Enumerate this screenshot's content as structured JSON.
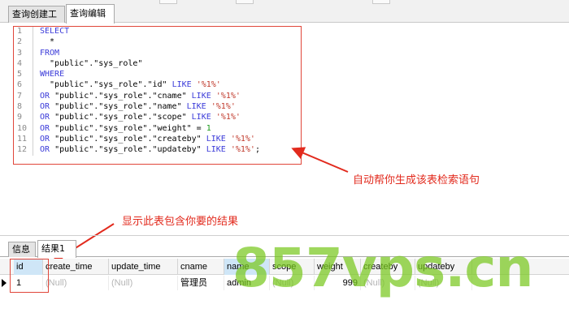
{
  "top_tabs": [
    "查询创建工具",
    "查询编辑器"
  ],
  "active_top_tab": 1,
  "sql": {
    "lines": [
      {
        "n": "1",
        "parts": [
          {
            "t": "SELECT",
            "c": "kw"
          }
        ]
      },
      {
        "n": "2",
        "parts": [
          {
            "t": "  *",
            "c": ""
          }
        ]
      },
      {
        "n": "3",
        "parts": [
          {
            "t": "FROM",
            "c": "kw"
          }
        ]
      },
      {
        "n": "4",
        "parts": [
          {
            "t": "  \"public\".\"sys_role\"",
            "c": ""
          }
        ]
      },
      {
        "n": "5",
        "parts": [
          {
            "t": "WHERE",
            "c": "kw"
          }
        ]
      },
      {
        "n": "6",
        "parts": [
          {
            "t": "  \"public\".\"sys_role\".\"id\" ",
            "c": ""
          },
          {
            "t": "LIKE",
            "c": "kw"
          },
          {
            "t": " ",
            "c": ""
          },
          {
            "t": "'%1%'",
            "c": "str"
          }
        ]
      },
      {
        "n": "7",
        "parts": [
          {
            "t": "OR",
            "c": "kw"
          },
          {
            "t": " \"public\".\"sys_role\".\"cname\" ",
            "c": ""
          },
          {
            "t": "LIKE",
            "c": "kw"
          },
          {
            "t": " ",
            "c": ""
          },
          {
            "t": "'%1%'",
            "c": "str"
          }
        ]
      },
      {
        "n": "8",
        "parts": [
          {
            "t": "OR",
            "c": "kw"
          },
          {
            "t": " \"public\".\"sys_role\".\"name\" ",
            "c": ""
          },
          {
            "t": "LIKE",
            "c": "kw"
          },
          {
            "t": " ",
            "c": ""
          },
          {
            "t": "'%1%'",
            "c": "str"
          }
        ]
      },
      {
        "n": "9",
        "parts": [
          {
            "t": "OR",
            "c": "kw"
          },
          {
            "t": " \"public\".\"sys_role\".\"scope\" ",
            "c": ""
          },
          {
            "t": "LIKE",
            "c": "kw"
          },
          {
            "t": " ",
            "c": ""
          },
          {
            "t": "'%1%'",
            "c": "str"
          }
        ]
      },
      {
        "n": "10",
        "parts": [
          {
            "t": "OR",
            "c": "kw"
          },
          {
            "t": " \"public\".\"sys_role\".\"weight\" = ",
            "c": ""
          },
          {
            "t": "1",
            "c": "num"
          }
        ]
      },
      {
        "n": "11",
        "parts": [
          {
            "t": "OR",
            "c": "kw"
          },
          {
            "t": " \"public\".\"sys_role\".\"createby\" ",
            "c": ""
          },
          {
            "t": "LIKE",
            "c": "kw"
          },
          {
            "t": " ",
            "c": ""
          },
          {
            "t": "'%1%'",
            "c": "str"
          }
        ]
      },
      {
        "n": "12",
        "parts": [
          {
            "t": "OR",
            "c": "kw"
          },
          {
            "t": " \"public\".\"sys_role\".\"updateby\" ",
            "c": ""
          },
          {
            "t": "LIKE",
            "c": "kw"
          },
          {
            "t": " ",
            "c": ""
          },
          {
            "t": "'%1%'",
            "c": "str"
          },
          {
            "t": ";",
            "c": ""
          }
        ]
      }
    ]
  },
  "annotations": {
    "auto_generate": "自动帮你生成该表检索语句",
    "shows_result": "显示此表包含你要的结果"
  },
  "result_tabs": [
    "信息",
    "结果1"
  ],
  "active_result_tab": 1,
  "grid": {
    "columns": [
      "id",
      "create_time",
      "update_time",
      "cname",
      "name",
      "scope",
      "weight",
      "createby",
      "updateby"
    ],
    "row": [
      "1",
      "(Null)",
      "(Null)",
      "管理员",
      "admin",
      "(Null)",
      "999",
      "(Null)",
      "(Null)"
    ]
  },
  "watermark": "857vps.cn",
  "colors": {
    "annotation": "#e22a1d",
    "keyword": "#3b3bd9",
    "string": "#c0392b",
    "number": "#1a9a1a",
    "watermark": "#78c81e"
  }
}
